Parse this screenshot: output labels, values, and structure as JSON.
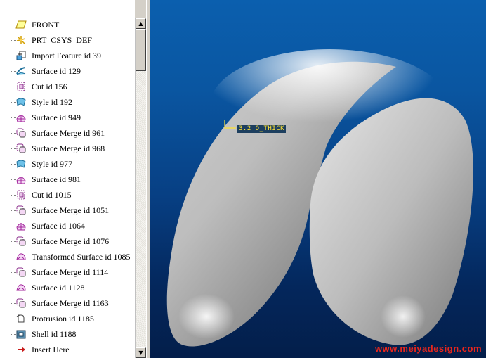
{
  "model_tree": {
    "items": [
      {
        "label": "FRONT",
        "icon": "datum-plane-icon"
      },
      {
        "label": "PRT_CSYS_DEF",
        "icon": "coordinate-system-icon"
      },
      {
        "label": "Import Feature id 39",
        "icon": "import-feature-icon"
      },
      {
        "label": "Surface id 129",
        "icon": "surface-icon"
      },
      {
        "label": "Cut id 156",
        "icon": "cut-icon"
      },
      {
        "label": "Style id 192",
        "icon": "style-icon"
      },
      {
        "label": "Surface id 949",
        "icon": "surface-patch-icon"
      },
      {
        "label": "Surface Merge id 961",
        "icon": "surface-merge-icon"
      },
      {
        "label": "Surface Merge id 968",
        "icon": "surface-merge-icon"
      },
      {
        "label": "Style id 977",
        "icon": "style-icon"
      },
      {
        "label": "Surface id 981",
        "icon": "surface-patch-icon"
      },
      {
        "label": "Cut id 1015",
        "icon": "cut-icon"
      },
      {
        "label": "Surface Merge id 1051",
        "icon": "surface-merge-icon"
      },
      {
        "label": "Surface id 1064",
        "icon": "surface-patch-icon"
      },
      {
        "label": "Surface Merge id 1076",
        "icon": "surface-merge-icon"
      },
      {
        "label": "Transformed Surface id 1085",
        "icon": "transformed-surface-icon"
      },
      {
        "label": "Surface Merge id 1114",
        "icon": "surface-merge-icon"
      },
      {
        "label": "Surface id 1128",
        "icon": "surface-patch-icon"
      },
      {
        "label": "Surface Merge id 1163",
        "icon": "surface-merge-icon"
      },
      {
        "label": "Protrusion id 1185",
        "icon": "protrusion-icon"
      },
      {
        "label": "Shell id 1188",
        "icon": "shell-icon"
      },
      {
        "label": "Insert Here",
        "icon": "insert-here-arrow-icon"
      }
    ]
  },
  "viewport": {
    "dimension_label": "3.2 O_THICK",
    "watermark": "www.meiyadesign.com"
  },
  "colors": {
    "background_top": "#0b5fae",
    "background_bottom": "#031e4a",
    "dimension_text": "#ffe234",
    "watermark": "#e8261c"
  }
}
